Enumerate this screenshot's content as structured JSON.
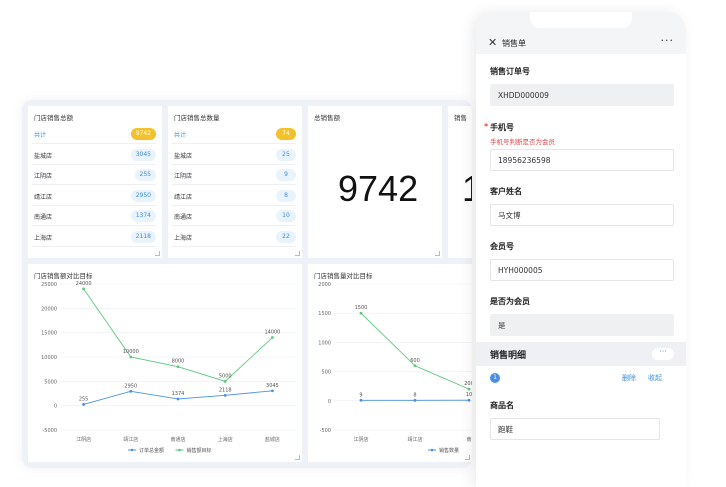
{
  "dashboard": {
    "store_total": {
      "title": "门店销售总额",
      "rows": [
        {
          "label": "共计",
          "value": "9742",
          "total": true
        },
        {
          "label": "盐城店",
          "value": "3045"
        },
        {
          "label": "江阴店",
          "value": "255"
        },
        {
          "label": "靖江店",
          "value": "2950"
        },
        {
          "label": "南通店",
          "value": "1374"
        },
        {
          "label": "上海店",
          "value": "2118"
        }
      ]
    },
    "store_qty": {
      "title": "门店销售总数量",
      "rows": [
        {
          "label": "共计",
          "value": "74",
          "total": true
        },
        {
          "label": "盐城店",
          "value": "25"
        },
        {
          "label": "江阴店",
          "value": "9"
        },
        {
          "label": "靖江店",
          "value": "8"
        },
        {
          "label": "南通店",
          "value": "10"
        },
        {
          "label": "上海店",
          "value": "22"
        }
      ]
    },
    "total_sales": {
      "title": "总销售额",
      "value": "9742"
    },
    "partial_card": {
      "title": "销售",
      "value": "1"
    }
  },
  "chart_data": [
    {
      "type": "line",
      "title": "门店销售额对比目标",
      "categories": [
        "江阴店",
        "靖江店",
        "南通店",
        "上海店",
        "盐城店"
      ],
      "yticks": [
        "25000",
        "20000",
        "15000",
        "10000",
        "5000",
        "0",
        "-5000"
      ],
      "ylim": [
        -5000,
        25000
      ],
      "series": [
        {
          "name": "订单总金额",
          "color": "#4a90e2",
          "values": [
            255,
            2950,
            1374,
            2118,
            3045
          ],
          "labels": [
            "255",
            "2950",
            "1374",
            "2118",
            "3045"
          ]
        },
        {
          "name": "销售额目标",
          "color": "#5cc97a",
          "values": [
            24000,
            10000,
            8000,
            5000,
            14000
          ],
          "labels": [
            "24000",
            "10000",
            "8000",
            "5000",
            "14000"
          ]
        }
      ],
      "legend": "bottom"
    },
    {
      "type": "line",
      "title": "门店销售量对比目标",
      "categories": [
        "江阴店",
        "靖江店",
        "南"
      ],
      "yticks": [
        "2000",
        "1500",
        "1000",
        "500",
        "0",
        "-500"
      ],
      "ylim": [
        -500,
        2000
      ],
      "series": [
        {
          "name": "销售数量",
          "color": "#4a90e2",
          "values": [
            9,
            8,
            10
          ],
          "labels": [
            "9",
            "8",
            "10"
          ]
        },
        {
          "name": "",
          "color": "#5cc97a",
          "values": [
            1500,
            600,
            200
          ],
          "labels": [
            "1500",
            "600",
            "200"
          ]
        }
      ],
      "legend": "bottom"
    }
  ],
  "form": {
    "title": "销售单",
    "close_icon": "close-icon",
    "more": "···",
    "order_no_label": "销售订单号",
    "order_no_value": "XHDD000009",
    "phone_label": "手机号",
    "phone_hint": "手机号判断是否为会员",
    "phone_value": "18956236598",
    "customer_label": "客户姓名",
    "customer_value": "马文博",
    "member_no_label": "会员号",
    "member_no_value": "HYH000005",
    "is_member_label": "是否为会员",
    "is_member_value": "是",
    "detail_section": "销售明细",
    "detail_more": "···",
    "item_index": "1",
    "delete_label": "删除",
    "collapse_label": "收起",
    "product_label": "商品名",
    "product_value": "跑鞋"
  }
}
